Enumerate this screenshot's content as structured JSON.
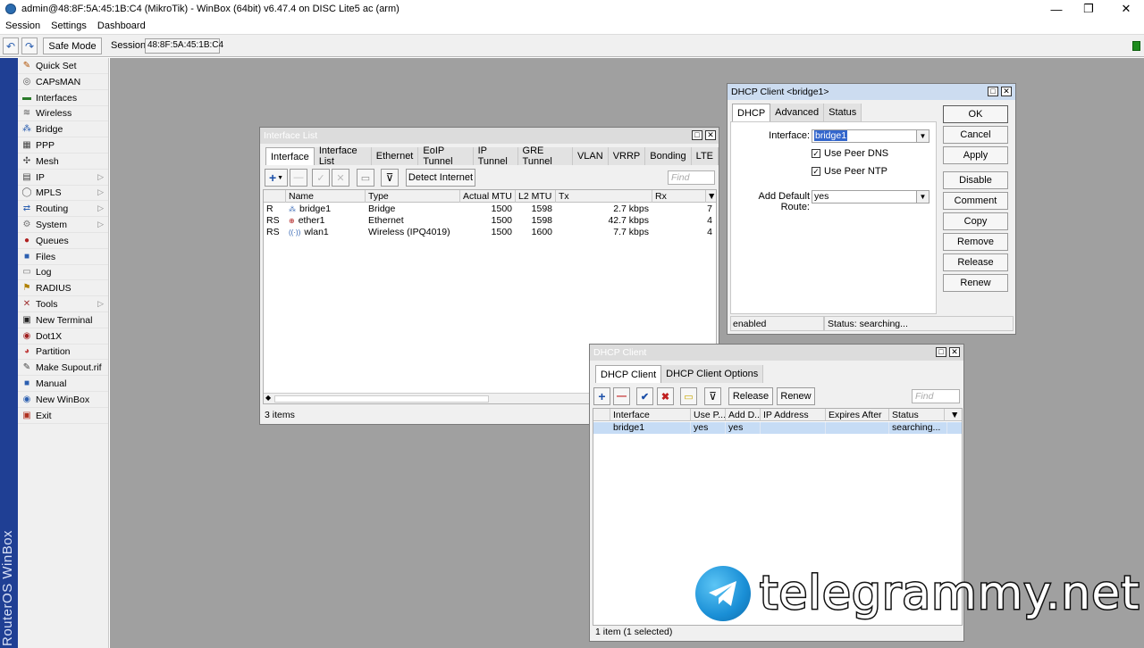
{
  "window": {
    "title": "admin@48:8F:5A:45:1B:C4 (MikroTik) - WinBox (64bit) v6.47.4 on DISC Lite5 ac (arm)",
    "minimize": "—",
    "maximize": "❐",
    "close": "✕"
  },
  "menu": [
    "Session",
    "Settings",
    "Dashboard"
  ],
  "toolbar": {
    "undo": "↶",
    "redo": "↷",
    "safe_mode": "Safe Mode",
    "session_label": "Session:",
    "session_value": "48:8F:5A:45:1B:C4"
  },
  "side_strip_text": "RouterOS WinBox",
  "sidebar": [
    {
      "label": "Quick Set",
      "icon": "wand-icon",
      "glyph": "✎",
      "color": "#b05000",
      "arrow": false
    },
    {
      "label": "CAPsMAN",
      "icon": "capsman-icon",
      "glyph": "◎",
      "color": "#555",
      "arrow": false
    },
    {
      "label": "Interfaces",
      "icon": "interfaces-icon",
      "glyph": "▬",
      "color": "#2a7a2a",
      "arrow": false
    },
    {
      "label": "Wireless",
      "icon": "wireless-icon",
      "glyph": "≋",
      "color": "#555",
      "arrow": false
    },
    {
      "label": "Bridge",
      "icon": "bridge-icon",
      "glyph": "⁂",
      "color": "#2b5fb0",
      "arrow": false
    },
    {
      "label": "PPP",
      "icon": "ppp-icon",
      "glyph": "▦",
      "color": "#444",
      "arrow": false
    },
    {
      "label": "Mesh",
      "icon": "mesh-icon",
      "glyph": "✣",
      "color": "#444",
      "arrow": false
    },
    {
      "label": "IP",
      "icon": "ip-icon",
      "glyph": "▤",
      "color": "#444",
      "arrow": true
    },
    {
      "label": "MPLS",
      "icon": "mpls-icon",
      "glyph": "◯",
      "color": "#666",
      "arrow": true
    },
    {
      "label": "Routing",
      "icon": "routing-icon",
      "glyph": "⇄",
      "color": "#2b5fb0",
      "arrow": true
    },
    {
      "label": "System",
      "icon": "system-icon",
      "glyph": "⚙",
      "color": "#777",
      "arrow": true
    },
    {
      "label": "Queues",
      "icon": "queues-icon",
      "glyph": "●",
      "color": "#b02020",
      "arrow": false
    },
    {
      "label": "Files",
      "icon": "files-icon",
      "glyph": "■",
      "color": "#2b5fb0",
      "arrow": false
    },
    {
      "label": "Log",
      "icon": "log-icon",
      "glyph": "▭",
      "color": "#777",
      "arrow": false
    },
    {
      "label": "RADIUS",
      "icon": "radius-icon",
      "glyph": "⚑",
      "color": "#b08000",
      "arrow": false
    },
    {
      "label": "Tools",
      "icon": "tools-icon",
      "glyph": "✕",
      "color": "#a03030",
      "arrow": true
    },
    {
      "label": "New Terminal",
      "icon": "terminal-icon",
      "glyph": "▣",
      "color": "#222",
      "arrow": false
    },
    {
      "label": "Dot1X",
      "icon": "dot1x-icon",
      "glyph": "◉",
      "color": "#a02020",
      "arrow": false
    },
    {
      "label": "Partition",
      "icon": "partition-icon",
      "glyph": "◕",
      "color": "#c04040",
      "arrow": false
    },
    {
      "label": "Make Supout.rif",
      "icon": "supout-icon",
      "glyph": "✎",
      "color": "#444",
      "arrow": false
    },
    {
      "label": "Manual",
      "icon": "manual-icon",
      "glyph": "■",
      "color": "#2b5fb0",
      "arrow": false
    },
    {
      "label": "New WinBox",
      "icon": "winbox-icon",
      "glyph": "◉",
      "color": "#2b5fb0",
      "arrow": false
    },
    {
      "label": "Exit",
      "icon": "exit-icon",
      "glyph": "▣",
      "color": "#b03020",
      "arrow": false
    }
  ],
  "interface_list": {
    "title": "Interface List",
    "tabs": [
      "Interface",
      "Interface List",
      "Ethernet",
      "EoIP Tunnel",
      "IP Tunnel",
      "GRE Tunnel",
      "VLAN",
      "VRRP",
      "Bonding",
      "LTE"
    ],
    "detect_button": "Detect Internet",
    "find_placeholder": "Find",
    "columns": [
      "",
      "Name",
      "Type",
      "Actual MTU",
      "L2 MTU",
      "Tx",
      "Rx"
    ],
    "rows": [
      {
        "flag": "R",
        "name": "bridge1",
        "type": "Bridge",
        "mtu": "1500",
        "l2mtu": "1598",
        "tx": "2.7 kbps",
        "rx": "7",
        "icon": "bridge-icon"
      },
      {
        "flag": "RS",
        "name": "ether1",
        "type": "Ethernet",
        "mtu": "1500",
        "l2mtu": "1598",
        "tx": "42.7 kbps",
        "rx": "4",
        "icon": "ethernet-icon"
      },
      {
        "flag": "RS",
        "name": "wlan1",
        "type": "Wireless (IPQ4019)",
        "mtu": "1500",
        "l2mtu": "1600",
        "tx": "7.7 kbps",
        "rx": "4",
        "icon": "wireless-icon"
      }
    ],
    "status": "3 items"
  },
  "dhcp_bridge": {
    "title": "DHCP Client <bridge1>",
    "tabs": [
      "DHCP",
      "Advanced",
      "Status"
    ],
    "interface_label": "Interface:",
    "interface_value": "bridge1",
    "use_peer_dns": "Use Peer DNS",
    "use_peer_ntp": "Use Peer NTP",
    "default_route_label": "Add Default Route:",
    "default_route_value": "yes",
    "buttons": [
      "OK",
      "Cancel",
      "Apply",
      "Disable",
      "Comment",
      "Copy",
      "Remove",
      "Release",
      "Renew"
    ],
    "status_left": "enabled",
    "status_right": "Status: searching..."
  },
  "dhcp_client": {
    "title": "DHCP Client",
    "tabs": [
      "DHCP Client",
      "DHCP Client Options"
    ],
    "release_button": "Release",
    "renew_button": "Renew",
    "find_placeholder": "Find",
    "columns": [
      "Interface",
      "Use P...",
      "Add D...",
      "IP Address",
      "Expires After",
      "Status"
    ],
    "rows": [
      {
        "interface": "bridge1",
        "use_peer": "yes",
        "add_default": "yes",
        "ip": "",
        "expires": "",
        "status": "searching..."
      }
    ],
    "status": "1 item (1 selected)"
  },
  "watermark": "telegrammy.net",
  "colors": {
    "strip": "#1f3f94",
    "desktop": "#a0a0a0",
    "selection": "#c6dcf5",
    "led": "#1e8c1e"
  }
}
